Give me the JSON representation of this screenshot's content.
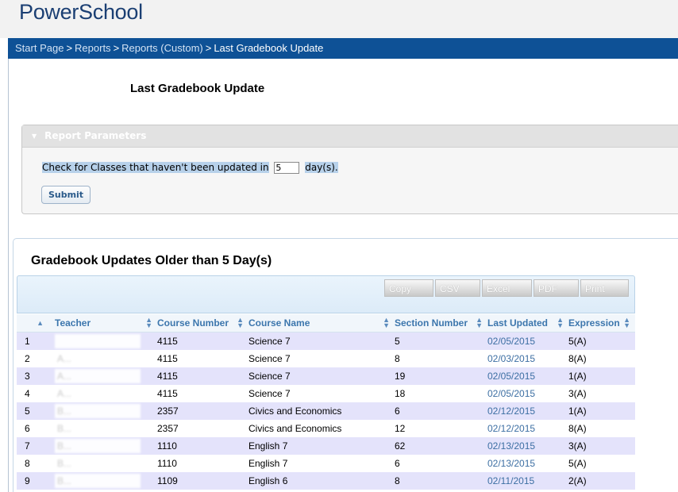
{
  "app": {
    "logo": "PowerSchool"
  },
  "breadcrumb": [
    {
      "label": "Start Page",
      "link": true
    },
    {
      "label": "Reports",
      "link": true
    },
    {
      "label": "Reports (Custom)",
      "link": true
    },
    {
      "label": "Last Gradebook Update",
      "link": false
    }
  ],
  "breadcrumb_separator": ">",
  "page": {
    "title": "Last Gradebook Update"
  },
  "params": {
    "header": "Report Parameters",
    "label_before": "Check for Classes that haven't been updated in",
    "days_value": "5",
    "label_after": "day(s).",
    "submit_label": "Submit"
  },
  "results": {
    "title": "Gradebook Updates Older than 5 Day(s)",
    "export_buttons": [
      "Copy",
      "CSV",
      "Excel",
      "PDF",
      "Print"
    ],
    "columns": [
      "",
      "Teacher",
      "Course Number",
      "Course Name",
      "Section Number",
      "Last Updated",
      "Expression"
    ],
    "rows": [
      {
        "n": "1",
        "teacher": "",
        "course_number": "4115",
        "course_name": "Science 7",
        "section": "5",
        "last_updated": "02/05/2015",
        "expression": "5(A)"
      },
      {
        "n": "2",
        "teacher": "A...",
        "course_number": "4115",
        "course_name": "Science 7",
        "section": "8",
        "last_updated": "02/03/2015",
        "expression": "8(A)"
      },
      {
        "n": "3",
        "teacher": "A...",
        "course_number": "4115",
        "course_name": "Science 7",
        "section": "19",
        "last_updated": "02/05/2015",
        "expression": "1(A)"
      },
      {
        "n": "4",
        "teacher": "A...",
        "course_number": "4115",
        "course_name": "Science 7",
        "section": "18",
        "last_updated": "02/05/2015",
        "expression": "3(A)"
      },
      {
        "n": "5",
        "teacher": "B...",
        "course_number": "2357",
        "course_name": "Civics and Economics",
        "section": "6",
        "last_updated": "02/12/2015",
        "expression": "1(A)"
      },
      {
        "n": "6",
        "teacher": "B...",
        "course_number": "2357",
        "course_name": "Civics and Economics",
        "section": "12",
        "last_updated": "02/12/2015",
        "expression": "8(A)"
      },
      {
        "n": "7",
        "teacher": "B...",
        "course_number": "1110",
        "course_name": "English 7",
        "section": "62",
        "last_updated": "02/13/2015",
        "expression": "3(A)"
      },
      {
        "n": "8",
        "teacher": "B...",
        "course_number": "1110",
        "course_name": "English 7",
        "section": "6",
        "last_updated": "02/13/2015",
        "expression": "5(A)"
      },
      {
        "n": "9",
        "teacher": "B...",
        "course_number": "1109",
        "course_name": "English 6",
        "section": "8",
        "last_updated": "02/11/2015",
        "expression": "2(A)"
      }
    ]
  },
  "colors": {
    "brand_blue": "#0e5196",
    "header_text": "#3c76ad",
    "row_stripe": "#e4e3fb",
    "date_link": "#3d6fa3"
  },
  "icons": {
    "param_toggle": "triangle-down-icon",
    "sort": "sort-arrows-icon",
    "sort_active": "sort-asc-icon"
  }
}
